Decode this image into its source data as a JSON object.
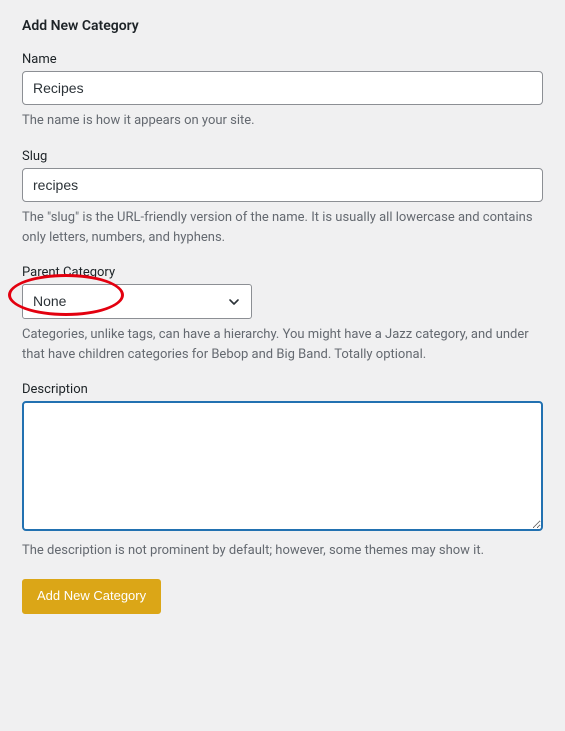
{
  "page": {
    "title": "Add New Category"
  },
  "fields": {
    "name": {
      "label": "Name",
      "value": "Recipes",
      "hint": "The name is how it appears on your site."
    },
    "slug": {
      "label": "Slug",
      "value": "recipes",
      "hint": "The \"slug\" is the URL-friendly version of the name. It is usually all lowercase and contains only letters, numbers, and hyphens."
    },
    "parent": {
      "label": "Parent Category",
      "selected": "None",
      "hint": "Categories, unlike tags, can have a hierarchy. You might have a Jazz category, and under that have children categories for Bebop and Big Band. Totally optional."
    },
    "description": {
      "label": "Description",
      "value": "",
      "hint": "The description is not prominent by default; however, some themes may show it."
    }
  },
  "submit": {
    "label": "Add New Category"
  }
}
